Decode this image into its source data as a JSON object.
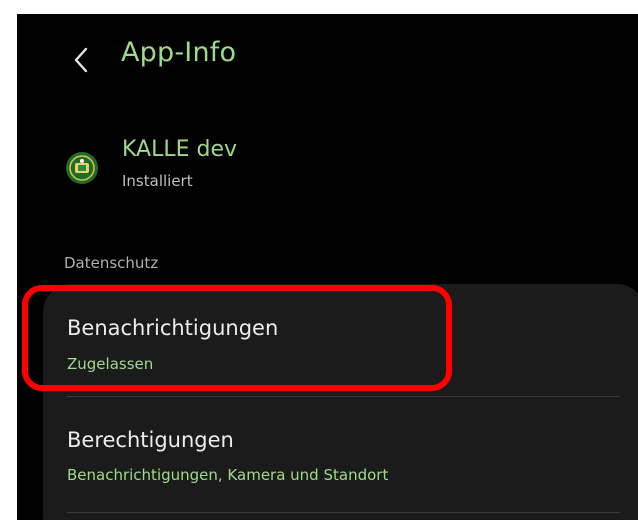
{
  "header": {
    "title": "App-Info",
    "back_icon": "chevron-left-icon"
  },
  "app": {
    "name": "KALLE dev",
    "status": "Installiert",
    "icon": "app-logo-icon"
  },
  "section": {
    "label": "Datenschutz"
  },
  "items": [
    {
      "title": "Benachrichtigungen",
      "subtitle": "Zugelassen"
    },
    {
      "title": "Berechtigungen",
      "subtitle": "Benachrichtigungen, Kamera und Standort"
    }
  ],
  "colors": {
    "accent": "#9fda8a",
    "background": "#000000",
    "card": "#1b1b1b",
    "highlight": "#ff0000"
  }
}
